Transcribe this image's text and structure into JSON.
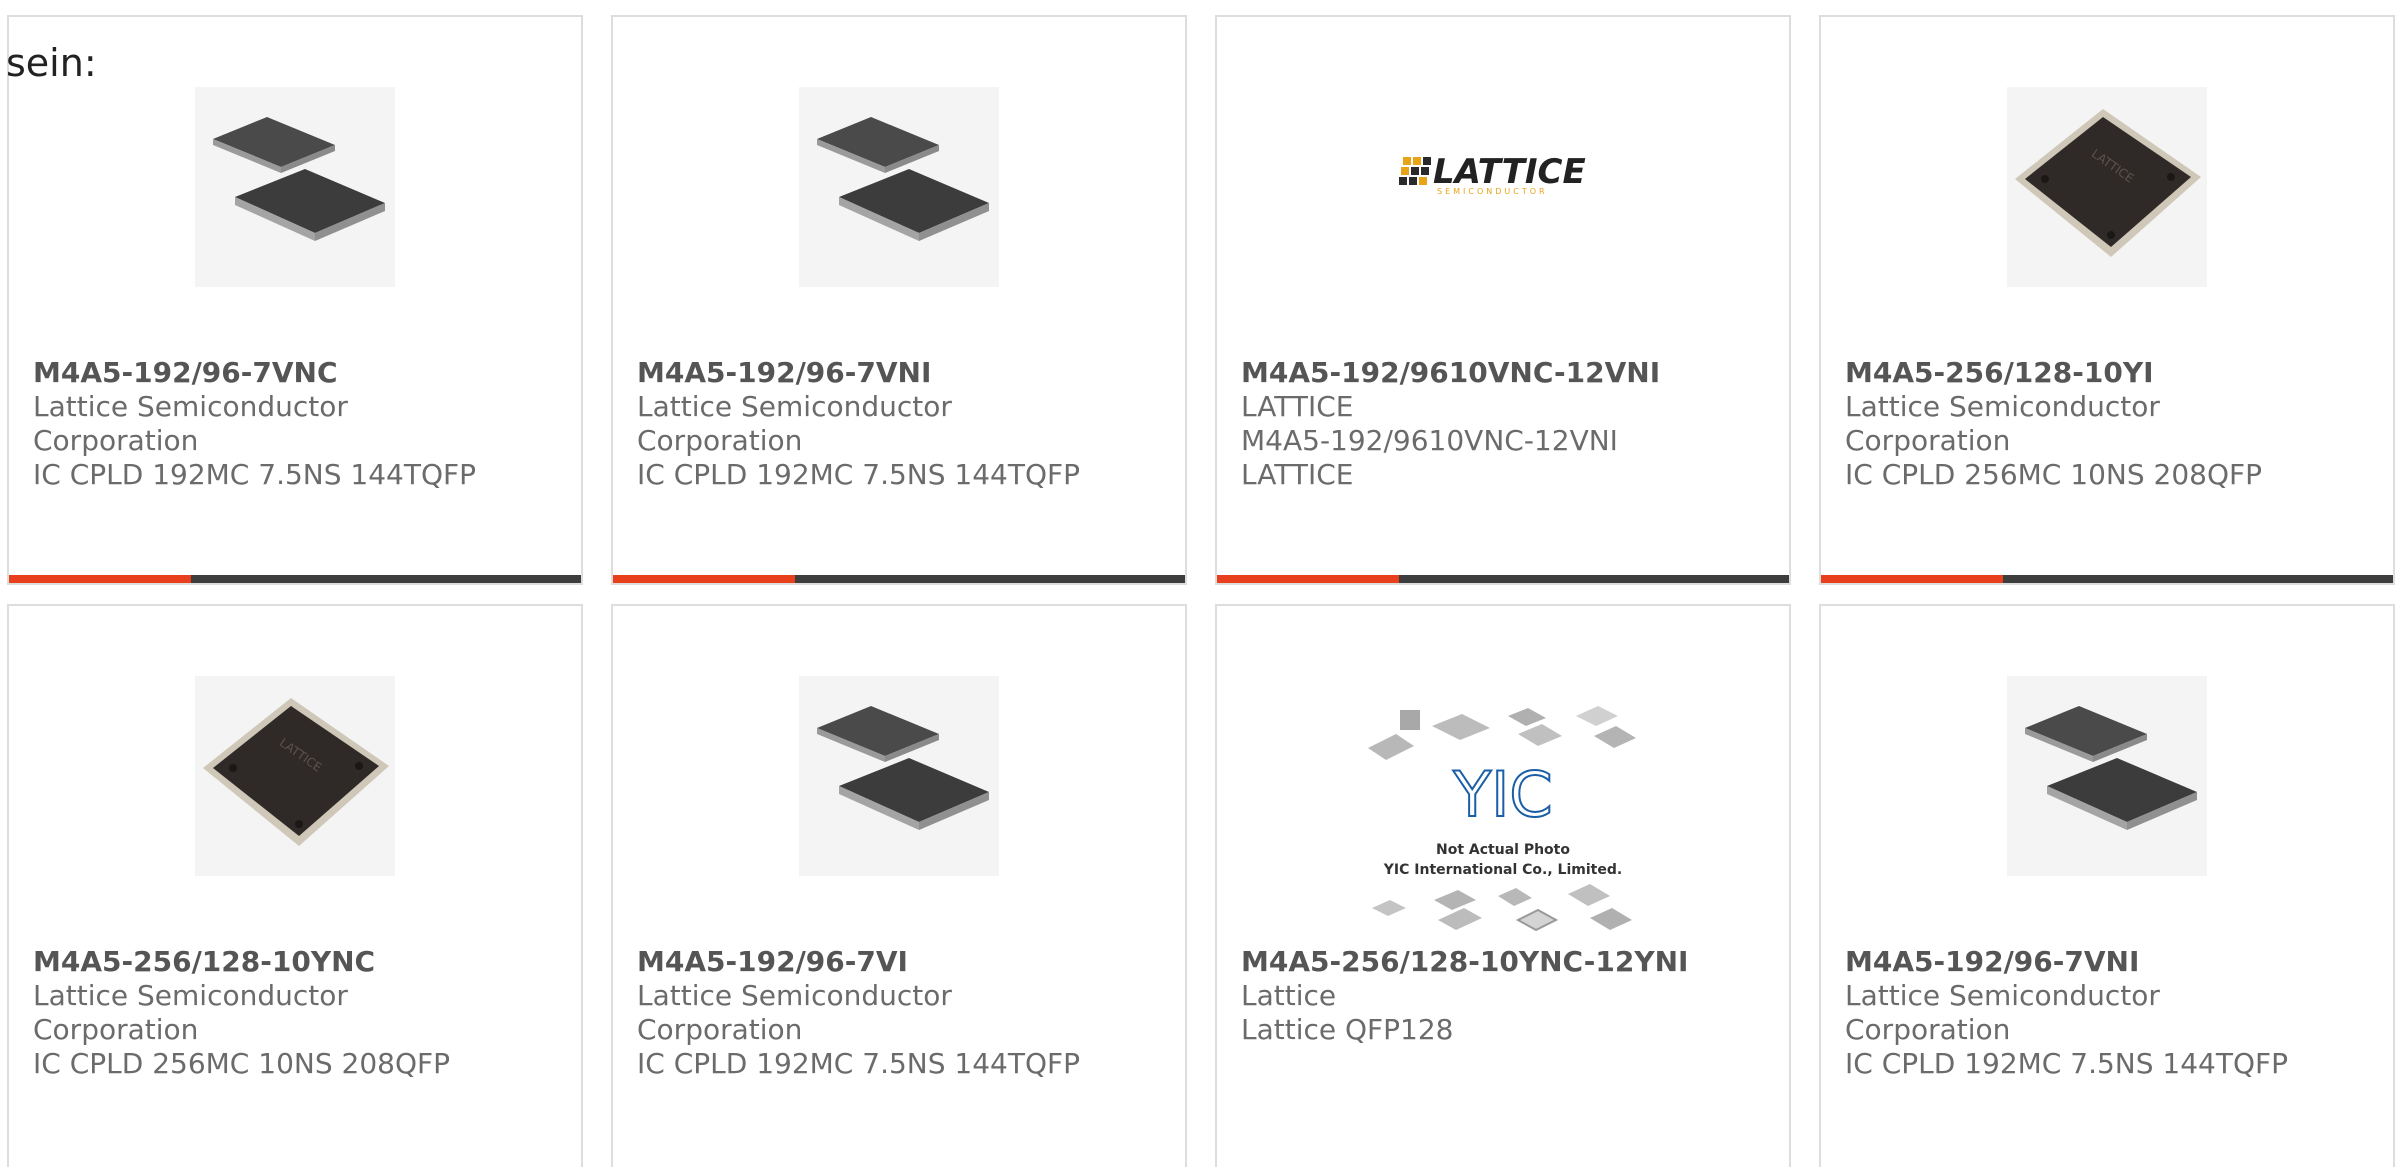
{
  "intro_text": "sein:",
  "colors": {
    "accent": "#e8401c",
    "bar": "#3d3d3d",
    "border": "#dddddd",
    "text": "#6b6b6b"
  },
  "cards": [
    {
      "part": "M4A5-192/96-7VNC",
      "lines": [
        "Lattice Semiconductor",
        "Corporation",
        "IC CPLD 192MC 7.5NS 144TQFP"
      ],
      "image": "chip-stack-icon"
    },
    {
      "part": "M4A5-192/96-7VNI",
      "lines": [
        "Lattice Semiconductor",
        "Corporation",
        "IC CPLD 192MC 7.5NS 144TQFP"
      ],
      "image": "chip-stack-icon"
    },
    {
      "part": "M4A5-192/9610VNC-12VNI",
      "lines": [
        "LATTICE",
        "M4A5-192/9610VNC-12VNI",
        "LATTICE"
      ],
      "image": "lattice-logo",
      "logo_word": "LATTICE",
      "logo_sub": "SEMICONDUCTOR"
    },
    {
      "part": "M4A5-256/128-10YI",
      "lines": [
        "Lattice Semiconductor",
        "Corporation",
        "IC CPLD 256MC 10NS 208QFP"
      ],
      "image": "qfp-chip-icon"
    },
    {
      "part": "M4A5-256/128-10YNC",
      "lines": [
        "Lattice Semiconductor",
        "Corporation",
        "IC CPLD 256MC 10NS 208QFP"
      ],
      "image": "qfp-chip-icon"
    },
    {
      "part": "M4A5-192/96-7VI",
      "lines": [
        "Lattice Semiconductor",
        "Corporation",
        "IC CPLD 192MC 7.5NS 144TQFP"
      ],
      "image": "chip-stack-icon"
    },
    {
      "part": "M4A5-256/128-10YNC-12YNI",
      "lines": [
        "Lattice",
        "Lattice QFP128"
      ],
      "image": "yic-placeholder",
      "yic_logo": "YIC",
      "yic_line1": "Not Actual Photo",
      "yic_line2": "YIC International Co., Limited."
    },
    {
      "part": "M4A5-192/96-7VNI",
      "lines": [
        "Lattice Semiconductor",
        "Corporation",
        "IC CPLD 192MC 7.5NS 144TQFP"
      ],
      "image": "chip-stack-icon"
    }
  ]
}
